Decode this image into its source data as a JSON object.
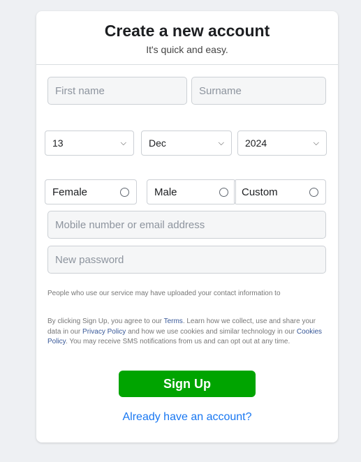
{
  "header": {
    "title": "Create a new account",
    "subtitle": "It's quick and easy."
  },
  "name": {
    "first_placeholder": "First name",
    "surname_placeholder": "Surname"
  },
  "dob": {
    "day": "13",
    "month": "Dec",
    "year": "2024"
  },
  "gender": {
    "options": [
      "Female",
      "Male",
      "Custom"
    ]
  },
  "contact": {
    "placeholder": "Mobile number or email address"
  },
  "password": {
    "placeholder": "New password"
  },
  "terms": {
    "notice": "People who use our service may have uploaded your contact information to",
    "line_prefix": "By clicking Sign Up, you agree to our ",
    "terms_link": "Terms",
    "line_mid1": ". Learn how we collect, use and share your data in our ",
    "privacy_link": "Privacy Policy",
    "line_mid2": " and how we use cookies and similar technology in our ",
    "cookies_link": "Cookies Policy",
    "line_suffix": ". You may receive SMS notifications from us and can opt out at any time."
  },
  "actions": {
    "signup_label": "Sign Up",
    "login_link": "Already have an account?"
  },
  "colors": {
    "primary_button": "#00a400",
    "link": "#1877f2"
  }
}
